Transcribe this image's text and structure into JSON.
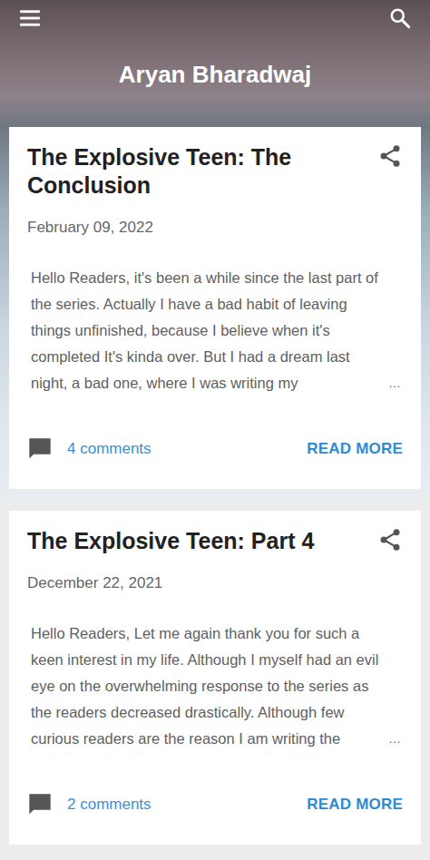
{
  "header": {
    "title": "Aryan Bharadwaj"
  },
  "posts": [
    {
      "title": "The Explosive Teen: The Conclusion",
      "date": "February 09, 2022",
      "excerpt": "Hello Readers, it's been a while since the last part of the series. Actually I have a bad habit of leaving things unfinished, because I believe when it's completed It's kinda over. But I had a dream last night, a bad one, where I was writing my",
      "ellipsis": "…",
      "comments": "4 comments",
      "read_more": "READ MORE"
    },
    {
      "title": "The Explosive Teen: Part 4",
      "date": "December 22, 2021",
      "excerpt": "Hello Readers, Let me again thank you for such a keen interest in my life. Although I myself had an evil eye on the overwhelming response to the series as the readers decreased drastically. Although few curious readers are the reason I am writing the",
      "ellipsis": "…",
      "comments": "2 comments",
      "read_more": "READ MORE"
    }
  ]
}
